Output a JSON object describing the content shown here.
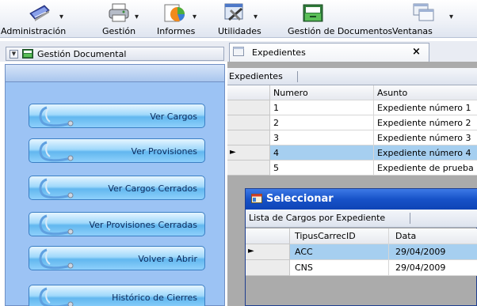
{
  "toolbar": {
    "items": [
      {
        "label": "Administración",
        "icon": "notebook-icon"
      },
      {
        "label": "Gestión",
        "icon": "printer-icon"
      },
      {
        "label": "Informes",
        "icon": "chart-icon"
      },
      {
        "label": "Utilidades",
        "icon": "tools-icon"
      },
      {
        "label": "Gestión de Documentos",
        "icon": "folder-icon"
      },
      {
        "label": "Ventanas",
        "icon": "windows-icon"
      }
    ],
    "arrow": "▾"
  },
  "tabs": {
    "left": {
      "label": "Gestión Documental",
      "drop": "▼"
    },
    "right": {
      "label": "Expedientes",
      "close": "×"
    }
  },
  "nav": {
    "buttons": [
      {
        "label": "Ver Cargos"
      },
      {
        "label": "Ver Provisiones"
      },
      {
        "label": "Ver Cargos Cerrados"
      },
      {
        "label": "Ver Provisiones Cerradas"
      },
      {
        "label": "Volver a Abrir"
      },
      {
        "label": "Histórico de Cierres"
      }
    ]
  },
  "expedientes": {
    "title": "Expedientes",
    "columns": [
      "Numero",
      "Asunto"
    ],
    "rows": [
      {
        "numero": "1",
        "asunto": "Expediente número 1"
      },
      {
        "numero": "2",
        "asunto": "Expediente número 2"
      },
      {
        "numero": "3",
        "asunto": "Expediente número 3"
      },
      {
        "numero": "4",
        "asunto": "Expediente número 4"
      },
      {
        "numero": "5",
        "asunto": "Expediente de prueba"
      }
    ],
    "selected_row": 3,
    "row_pointer": "►"
  },
  "dialog": {
    "title": "Seleccionar",
    "toolbar_label": "Lista de Cargos por Expediente",
    "columns": [
      "TipusCarrecID",
      "Data"
    ],
    "rows": [
      {
        "tipus": "ACC",
        "data": "29/04/2009"
      },
      {
        "tipus": "CNS",
        "data": "29/04/2009"
      }
    ],
    "selected_row": 0,
    "row_pointer": "►"
  },
  "colors": {
    "nav_panel": "#9cc3f4",
    "grid_selected": "#a6cff0",
    "dialog_title": "#1752c8"
  }
}
